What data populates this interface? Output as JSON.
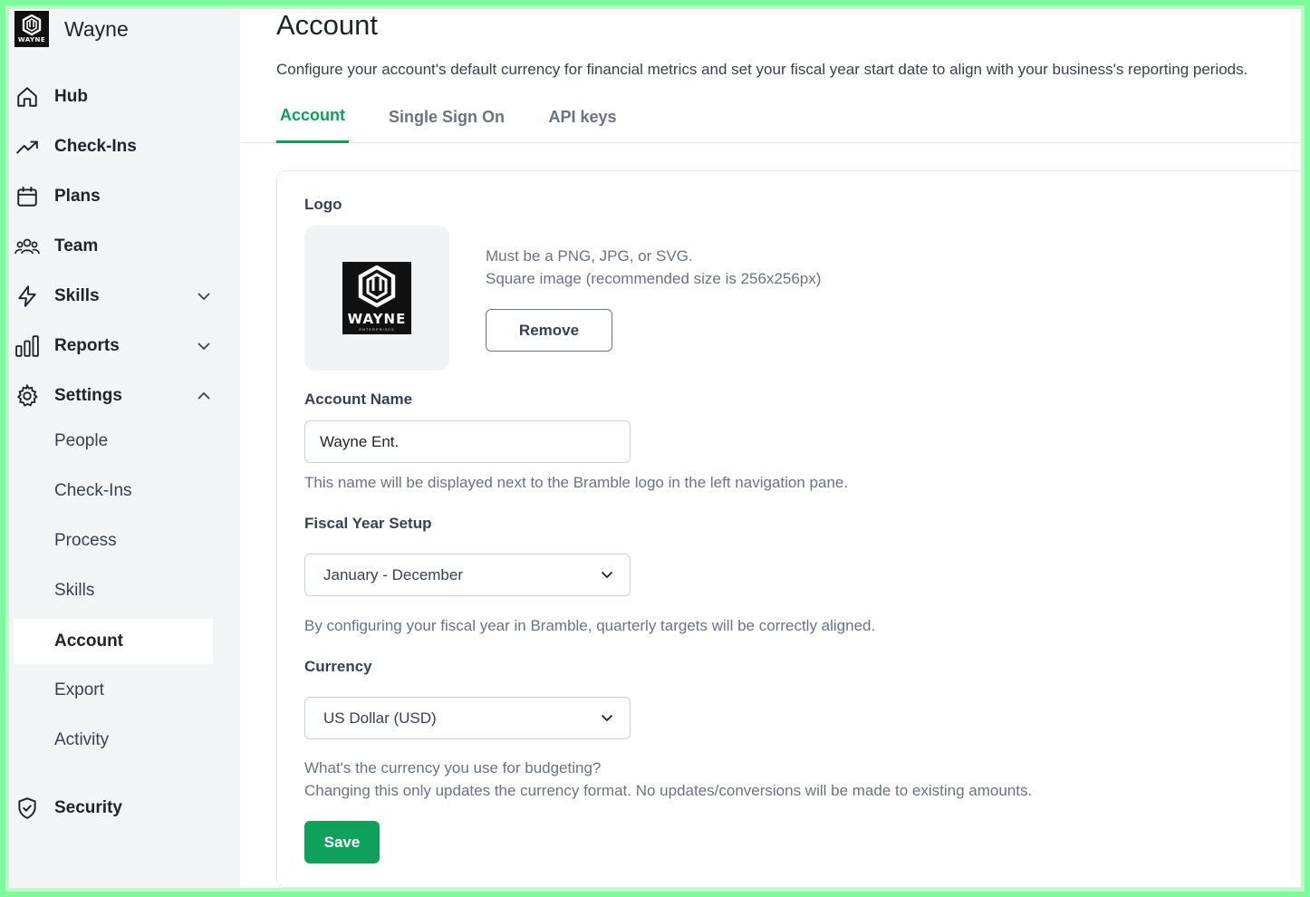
{
  "brand": {
    "name": "Wayne",
    "logo_text": "WAYNE",
    "logo_subtext": "ENTERPRISES"
  },
  "sidebar": {
    "items": [
      {
        "label": "Hub",
        "icon": "home-icon"
      },
      {
        "label": "Check-Ins",
        "icon": "trending-up-icon"
      },
      {
        "label": "Plans",
        "icon": "calendar-icon"
      },
      {
        "label": "Team",
        "icon": "users-icon"
      },
      {
        "label": "Skills",
        "icon": "lightning-icon",
        "expanded": false
      },
      {
        "label": "Reports",
        "icon": "bar-chart-icon",
        "expanded": false
      },
      {
        "label": "Settings",
        "icon": "gear-icon",
        "expanded": true
      },
      {
        "label": "Security",
        "icon": "shield-check-icon"
      }
    ],
    "settings_sub": [
      {
        "label": "People"
      },
      {
        "label": "Check-Ins"
      },
      {
        "label": "Process"
      },
      {
        "label": "Skills"
      },
      {
        "label": "Account",
        "active": true
      },
      {
        "label": "Export"
      },
      {
        "label": "Activity"
      }
    ]
  },
  "main": {
    "title": "Account",
    "description": "Configure your account's default currency for financial metrics and set your fiscal year start date to align with your business's reporting periods.",
    "tabs": [
      {
        "label": "Account",
        "active": true
      },
      {
        "label": "Single Sign On",
        "active": false
      },
      {
        "label": "API keys",
        "active": false
      }
    ]
  },
  "form": {
    "logo": {
      "label": "Logo",
      "hint_line1": "Must be a PNG, JPG, or SVG.",
      "hint_line2": "Square image (recommended size is 256x256px)",
      "remove_label": "Remove"
    },
    "account_name": {
      "label": "Account Name",
      "value": "Wayne Ent.",
      "hint": "This name will be displayed next to the Bramble logo in the left navigation pane."
    },
    "fiscal_year": {
      "label": "Fiscal Year Setup",
      "value": "January - December",
      "hint": "By configuring your fiscal year in Bramble, quarterly targets will be correctly aligned."
    },
    "currency": {
      "label": "Currency",
      "value": "US Dollar (USD)",
      "hint_line1": "What's the currency you use for budgeting?",
      "hint_line2": "Changing this only updates the currency format. No updates/conversions will be made to existing amounts."
    },
    "save_label": "Save"
  },
  "colors": {
    "accent": "#109f5b",
    "save_button": "#0fa15c",
    "sidebar_bg": "#f3f4f6",
    "frame": "#7dfb9a"
  }
}
